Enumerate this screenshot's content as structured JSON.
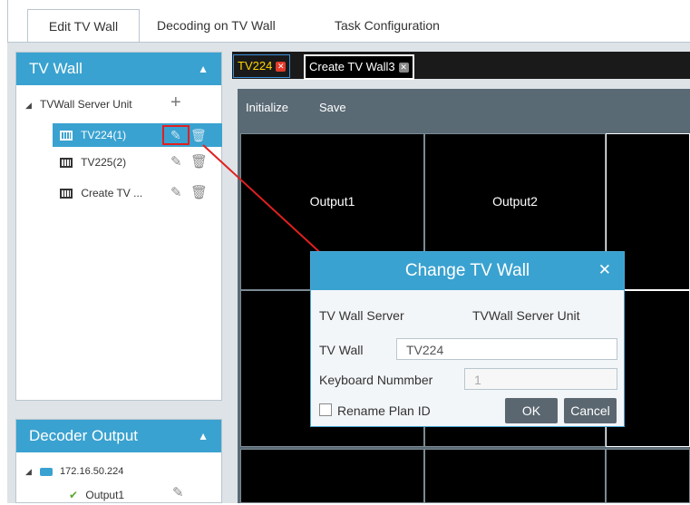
{
  "top_tabs": [
    "Edit TV Wall",
    "Decoding on TV Wall",
    "Task Configuration"
  ],
  "tvwall_panel": {
    "title": "TV Wall",
    "server_unit": "TVWall Server Unit",
    "items": [
      "TV224(1)",
      "TV225(2)",
      "Create TV ..."
    ]
  },
  "decoder_panel": {
    "title": "Decoder Output",
    "device": "172.16.50.224",
    "output": "Output1"
  },
  "wall_tabs": [
    "TV224",
    "Create TV Wall3"
  ],
  "toolbar": {
    "initialize": "Initialize",
    "save": "Save"
  },
  "cells": [
    "Output1",
    "Output2"
  ],
  "dialog": {
    "title": "Change TV Wall",
    "server_label": "TV Wall Server",
    "server_value": "TVWall Server Unit",
    "wall_label": "TV Wall",
    "wall_value": "TV224",
    "keyboard_label": "Keyboard Nummber",
    "keyboard_placeholder": "1",
    "rename_label": "Rename Plan ID",
    "ok": "OK",
    "cancel": "Cancel"
  },
  "colors": {
    "accent": "#3aa2d0",
    "selected_tab_text": "#ffd400",
    "close_red": "#e23a2a",
    "arrow": "#e02020"
  }
}
